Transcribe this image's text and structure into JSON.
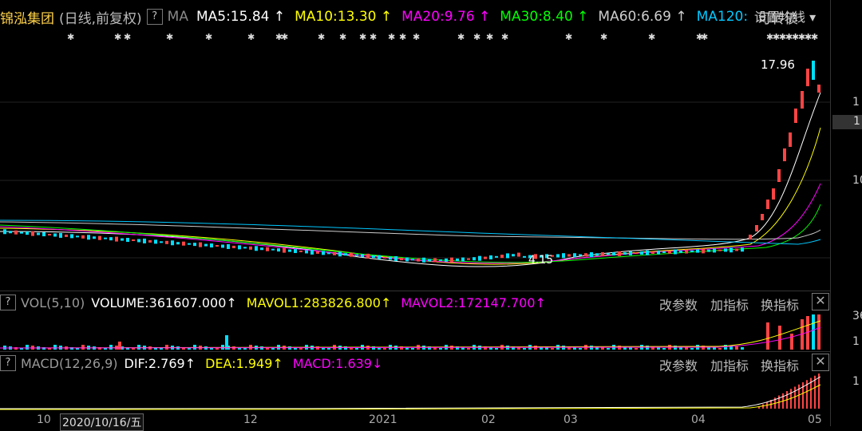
{
  "stock": {
    "name": "锦泓集团",
    "period": "(日线,前复权)",
    "help_icon": "?",
    "ma_label": "MA"
  },
  "ma_lines": [
    {
      "label": "MA5:15.84",
      "arrow": "↑",
      "color": "#ffffff"
    },
    {
      "label": "MA10:13.30",
      "arrow": "↑",
      "color": "#ffff00"
    },
    {
      "label": "MA20:9.76",
      "arrow": "↑",
      "color": "#ff00ff"
    },
    {
      "label": "MA30:8.40",
      "arrow": "↑",
      "color": "#00ff00"
    },
    {
      "label": "MA60:6.69",
      "arrow": "↑",
      "color": "#cccccc"
    },
    {
      "label": "MA120:",
      "arrow": "",
      "color": "#00c8ff"
    }
  ],
  "convertible_bond": "可转债",
  "settings_label": "设置均线 ▾",
  "price_annotations": {
    "high": "17.96",
    "low": "4.15"
  },
  "vol_panel": {
    "help_icon": "?",
    "title": "VOL(5,10)",
    "volume": "VOLUME:361607.000",
    "volume_arrow": "↑",
    "mavol1": "MAVOL1:283826.800",
    "mavol1_arrow": "↑",
    "mavol2": "MAVOL2:172147.700",
    "mavol2_arrow": "↑",
    "btn_params": "改参数",
    "btn_add": "加指标",
    "btn_switch": "换指标",
    "close": "✕"
  },
  "macd_panel": {
    "help_icon": "?",
    "title": "MACD(12,26,9)",
    "dif": "DIF:2.769",
    "dif_arrow": "↑",
    "dea": "DEA:1.949",
    "dea_arrow": "↑",
    "macd": "MACD:1.639",
    "macd_arrow": "↓",
    "btn_params": "改参数",
    "btn_add": "加指标",
    "btn_switch": "换指标",
    "close": "✕"
  },
  "right_scale": {
    "label_1": "1",
    "label_box": "1",
    "label_10": "10",
    "label_vol": "36",
    "label_vol2": "1",
    "label_macd": "1"
  },
  "x_axis": {
    "l10": "10",
    "date_box": "2020/10/16/五",
    "l12": "12",
    "l2021": "2021",
    "l02": "02",
    "l03": "03",
    "l04": "04",
    "l05": "05"
  }
}
